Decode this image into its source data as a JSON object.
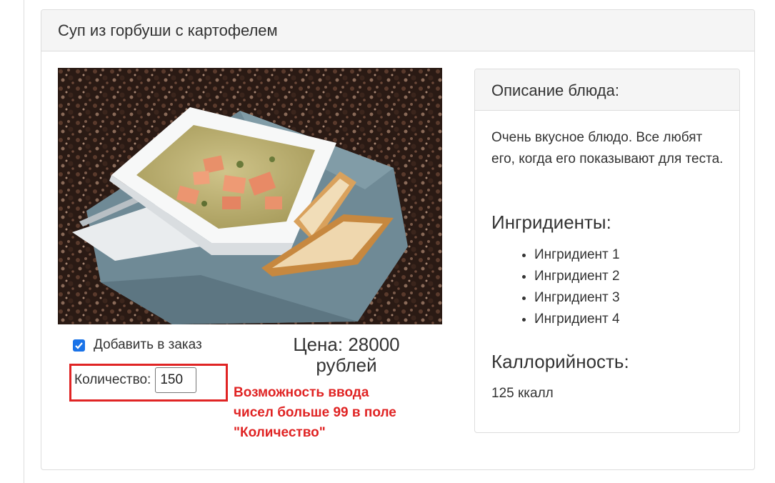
{
  "dish": {
    "title": "Суп из горбуши с картофелем",
    "image_alt": "Суп из горбуши с картофелем"
  },
  "order": {
    "add_checked": true,
    "add_label": "Добавить в заказ",
    "quantity_label": "Количество:",
    "quantity_value": "150",
    "price_text": "Цена: 28000 рублей"
  },
  "annotation": {
    "text": "Возможность ввода\nчисел больше 99 в поле\n\"Количество\"",
    "color": "#e02424"
  },
  "description": {
    "heading": "Описание блюда:",
    "text": "Очень вкусное блюдо. Все любят его, когда его показывают для теста.",
    "ingredients_title": "Ингридиенты:",
    "ingredients": [
      "Ингридиент 1",
      "Ингридиент 2",
      "Ингридиент 3",
      "Ингридиент 4"
    ],
    "calories_title": "Каллорийность:",
    "calories_value": "125 ккалл"
  },
  "colors": {
    "checkbox": "#1a73e8",
    "panel_heading_bg": "#f5f5f5",
    "border": "#dddddd"
  }
}
